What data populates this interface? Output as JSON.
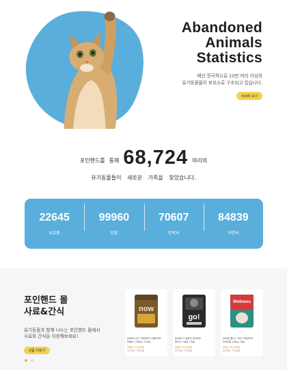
{
  "hero": {
    "title_lines": [
      "Abandoned",
      "Animals",
      "Statistics"
    ],
    "desc_lines": [
      "매년 전국적으로 10만 마리 이상의",
      "유기동물들이 보호소로 구조되고 있습니다."
    ],
    "button_label": "자세히 보기",
    "blob_color": "#5aaedb"
  },
  "counter": {
    "prefix": "포인핸드를",
    "mid": "통해",
    "value": "68,724",
    "suffix": "마리의",
    "sub": "유기동물들이 새로운 가족을 찾았습니다."
  },
  "stats": {
    "background": "#5aaedb",
    "items": [
      {
        "value": "22645",
        "label": "보호중"
      },
      {
        "value": "99960",
        "label": "입양"
      },
      {
        "value": "70607",
        "label": "안락사"
      },
      {
        "value": "84839",
        "label": "자연사"
      }
    ]
  },
  "products": {
    "title_lines": [
      "포인핸드 몰",
      "사료&간식"
    ],
    "desc_lines": [
      "유기동물과 함께 나누는 포인핸드 몰에서",
      "사료와 간식을 이용해보세요!"
    ],
    "button_label": "상품 더보기",
    "dots": [
      true,
      false
    ],
    "items": [
      {
        "brand": "now",
        "name_lines": [
          "[NEW] 나우 그레인프리 스몰브리드",
          "어덜트 1.36kg / 3.4kg"
        ],
        "price": "판매가 12,000원",
        "sub": "포인핸드 기부상품",
        "bag_color": "#7a5a2a",
        "accent": "#d9a43a"
      },
      {
        "brand": "go!",
        "name_lines": [
          "[NEW] 고 솔루션 센서티브",
          "캐나다 1.6kg / 5kg"
        ],
        "price": "판매가 15,000원",
        "sub": "포인핸드 기부상품",
        "bag_color": "#2a2a2a",
        "accent": "#c8c8c8"
      },
      {
        "brand": "Wellness",
        "name_lines": [
          "[NEW] 웰니스 코어 그레인프리",
          "오리지널 1.8kg / 5kg"
        ],
        "price": "판매가 18,000원",
        "sub": "포인핸드 기부상품",
        "bag_color": "#2e8f83",
        "accent": "#d23c3c"
      }
    ]
  }
}
